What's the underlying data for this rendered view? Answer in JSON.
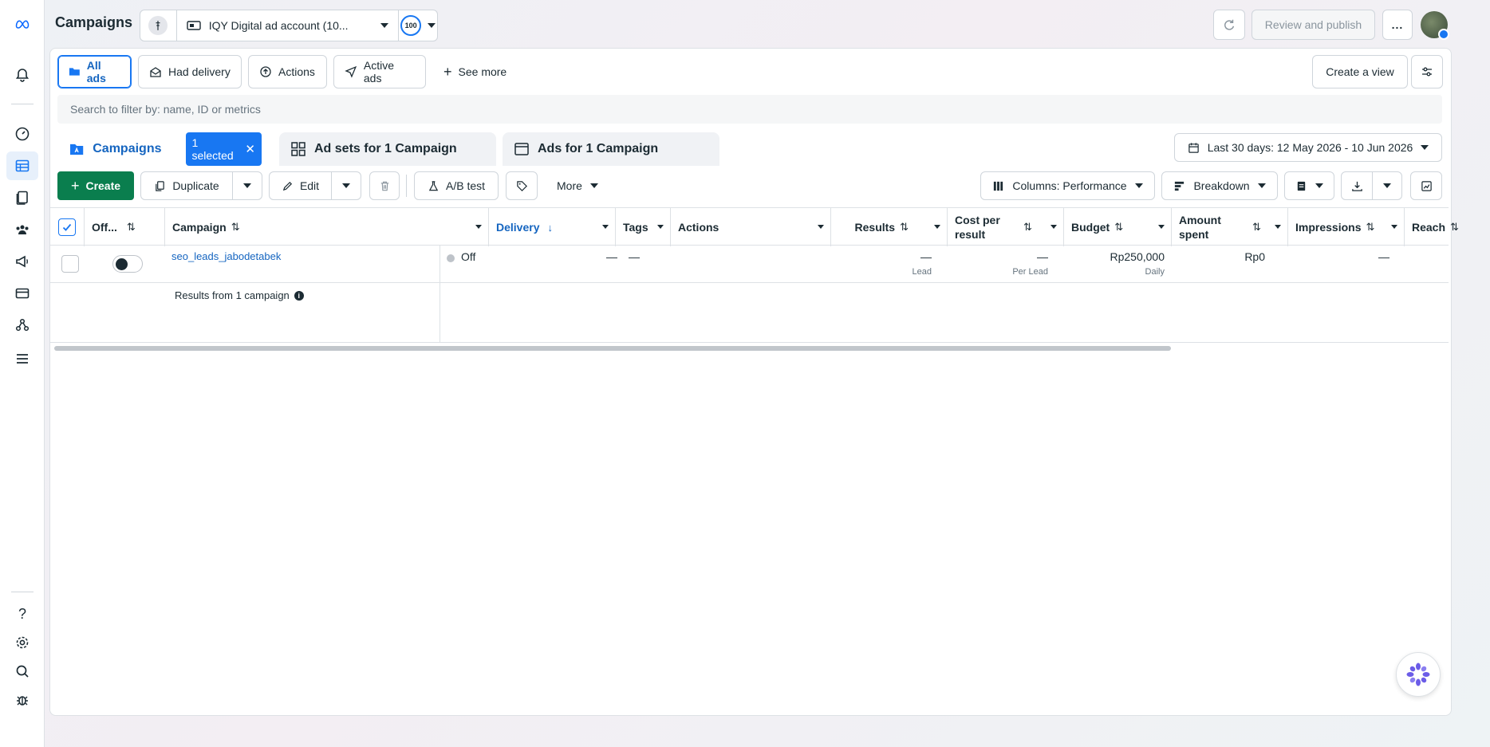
{
  "header": {
    "title": "Campaigns",
    "account_name": "IQY Digital ad account (10...",
    "score_badge": "100",
    "review_publish_label": "Review and publish",
    "more_label": "..."
  },
  "views": {
    "all_ads": "All ads",
    "had_delivery": "Had delivery",
    "actions": "Actions",
    "active_ads": "Active ads",
    "see_more": "See more",
    "create_view": "Create a view"
  },
  "search": {
    "placeholder": "Search to filter by: name, ID or metrics"
  },
  "tabs": {
    "campaigns": "Campaigns",
    "selected_badge": "1 selected",
    "ad_sets": "Ad sets for 1 Campaign",
    "ads": "Ads for 1 Campaign"
  },
  "date_range": "Last 30 days: 12 May 2026 - 10 Jun 2026",
  "toolbar": {
    "create": "Create",
    "duplicate": "Duplicate",
    "edit": "Edit",
    "ab_test": "A/B test",
    "more": "More",
    "columns": "Columns: Performance",
    "breakdown": "Breakdown"
  },
  "table": {
    "headers": {
      "off_on": "Off...",
      "campaign": "Campaign",
      "delivery": "Delivery",
      "tags": "Tags",
      "actions": "Actions",
      "results": "Results",
      "cost_per_result": "Cost per result",
      "budget": "Budget",
      "amount_spent": "Amount spent",
      "impressions": "Impressions",
      "reach": "Reach"
    },
    "row": {
      "campaign": "seo_leads_jabodetabek",
      "delivery": "Off",
      "tags": "—",
      "actions": "—",
      "results": "—",
      "results_sub": "Lead",
      "cost_per_result": "—",
      "cost_sub": "Per Lead",
      "budget": "Rp250,000",
      "budget_sub": "Daily",
      "amount_spent": "Rp0",
      "impressions": "—"
    },
    "summary": "Results from 1 campaign"
  },
  "colors": {
    "accent": "#1877f2",
    "create_green": "#0a7e4e"
  }
}
